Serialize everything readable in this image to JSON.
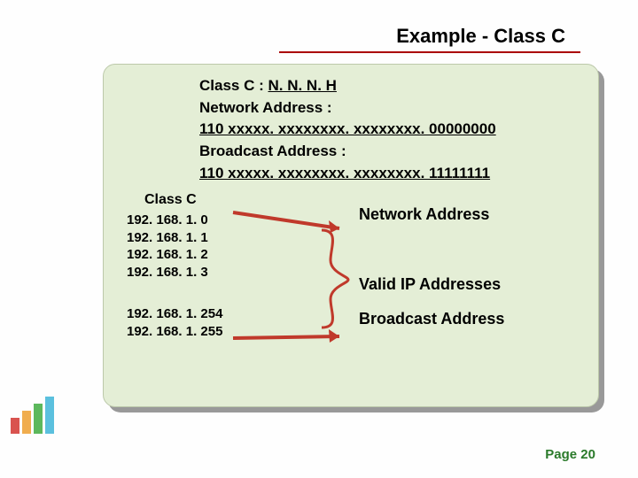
{
  "title": "Example - Class  C",
  "defs": {
    "line1_label": "Class C : ",
    "line1_value": "N. N. N. H",
    "line2_label": "Network Address :",
    "line3": "110 xxxxx. xxxxxxxx. xxxxxxxx. 00000000",
    "line4_label": "Broadcast Address :",
    "line5": "110 xxxxx. xxxxxxxx. xxxxxxxx. 11111111"
  },
  "ip": {
    "heading": "Class C",
    "addrs": [
      "192. 168. 1. 0",
      "192. 168. 1. 1",
      "192. 168. 1. 2",
      "192. 168. 1. 3"
    ],
    "addrs2": [
      "192. 168. 1. 254",
      "192. 168. 1. 255"
    ]
  },
  "labels": {
    "network": "Network Address",
    "valid": "Valid IP Addresses",
    "broadcast": "Broadcast Address"
  },
  "footer": "Page 20"
}
